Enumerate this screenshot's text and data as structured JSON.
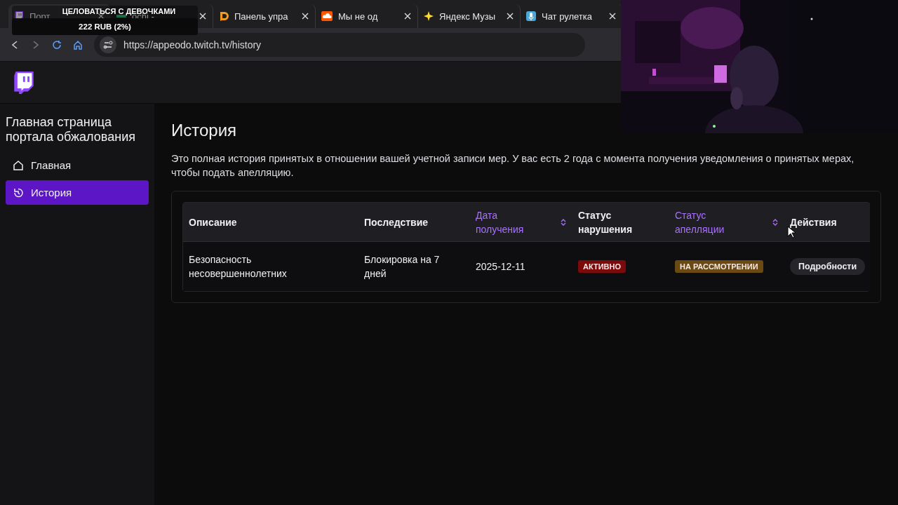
{
  "browser": {
    "tabs": [
      {
        "label": "Порт",
        "selected": true
      },
      {
        "label": "ochi -",
        "selected": false
      },
      {
        "label": "Панель упра",
        "selected": false
      },
      {
        "label": "Мы не од",
        "selected": false
      },
      {
        "label": "Яндекс Музы",
        "selected": false
      },
      {
        "label": "Чат рулетка",
        "selected": false
      }
    ],
    "url": "https://appeodo.twitch.tv/history"
  },
  "alert": {
    "title": "ЦЕЛОВАТЬСЯ С ДЕВОЧКАМИ",
    "amount": "222 RUB (2%)"
  },
  "sidebar": {
    "title": "Главная страница портала обжалования",
    "items": [
      {
        "label": "Главная",
        "selected": false
      },
      {
        "label": "История",
        "selected": true
      }
    ]
  },
  "page": {
    "title": "История",
    "description": "Это полная история принятых в отношении вашей учетной записи мер. У вас есть 2 года с момента получения уведомления о принятых мерах, чтобы подать апелляцию."
  },
  "table": {
    "columns": [
      {
        "label": "Описание",
        "sortable": false
      },
      {
        "label": "Последствие",
        "sortable": false
      },
      {
        "label": "Дата получения",
        "sortable": true
      },
      {
        "label": "Статус нарушения",
        "sortable": false
      },
      {
        "label": "Статус апелляции",
        "sortable": true
      },
      {
        "label": "Действия",
        "sortable": false
      }
    ],
    "rows": [
      {
        "cells": [
          {
            "kind": "text",
            "text": "Безопасность несовершеннолетних"
          },
          {
            "kind": "text",
            "text": "Блокировка на 7 дней"
          },
          {
            "kind": "text",
            "text": "2025-12-11"
          },
          {
            "kind": "badge",
            "text": "АКТИВНО",
            "color": "#7d0a0a"
          },
          {
            "kind": "badge",
            "text": "НА РАССМОТРЕНИИ",
            "color": "#6a4a12"
          },
          {
            "kind": "button",
            "text": "Подробности"
          }
        ]
      }
    ]
  }
}
